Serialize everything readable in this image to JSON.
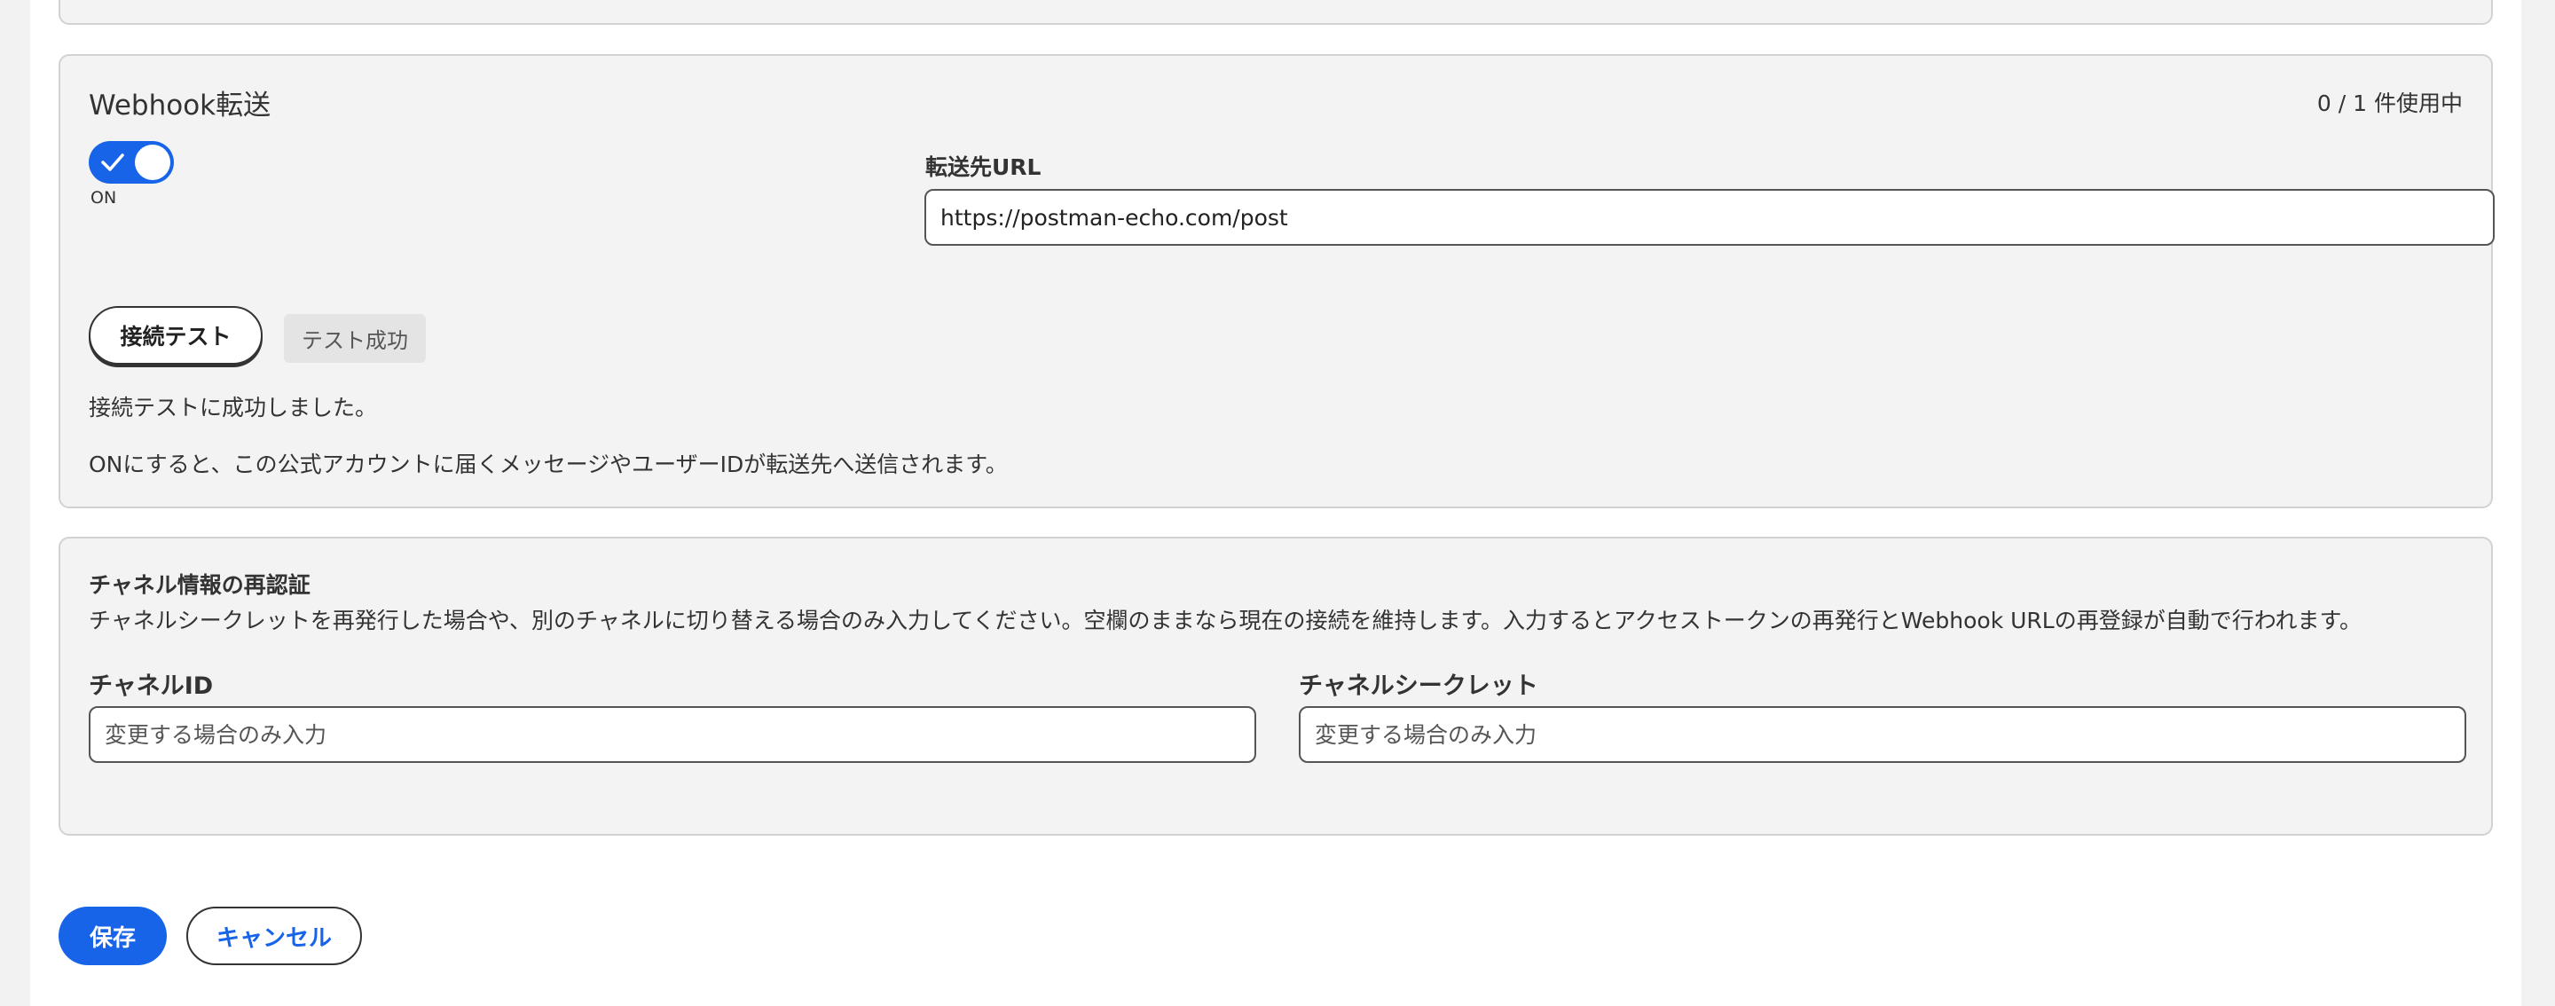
{
  "colors": {
    "accent": "#1864e8",
    "panel_bg": "#f3f3f3",
    "panel_border": "#d2d2d2",
    "outer_bg": "#f2f2f2",
    "text": "#333333"
  },
  "webhook": {
    "title": "Webhook転送",
    "usage": "0 / 1 件使用中",
    "toggle": {
      "state": "ON",
      "label": "ON",
      "icon": "check-icon"
    },
    "url_label": "転送先URL",
    "url_value": "https://postman-echo.com/post",
    "test_button_label": "接続テスト",
    "test_badge": "テスト成功",
    "test_message": "接続テストに成功しました。",
    "note": "ONにすると、この公式アカウントに届くメッセージやユーザーIDが転送先へ送信されます。"
  },
  "reauth": {
    "title": "チャネル情報の再認証",
    "description": "チャネルシークレットを再発行した場合や、別のチャネルに切り替える場合のみ入力してください。空欄のままなら現在の接続を維持します。入力するとアクセストークンの再発行とWebhook URLの再登録が自動で行われます。",
    "channel_id_label": "チャネルID",
    "channel_id_placeholder": "変更する場合のみ入力",
    "channel_secret_label": "チャネルシークレット",
    "channel_secret_placeholder": "変更する場合のみ入力"
  },
  "actions": {
    "save_label": "保存",
    "cancel_label": "キャンセル"
  }
}
